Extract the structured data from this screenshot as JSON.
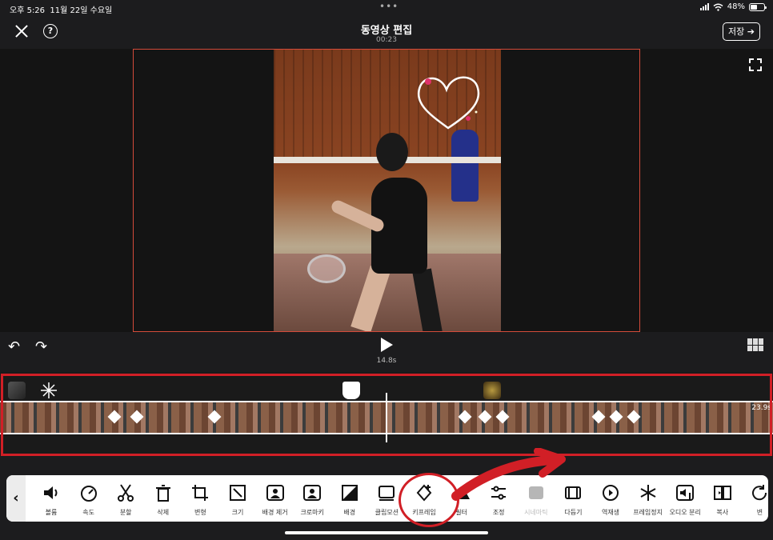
{
  "status": {
    "time": "오후 5:26",
    "date": "11월 22일 수요일",
    "battery": "48%"
  },
  "header": {
    "title": "동영상 편집",
    "subtitle": "00:23",
    "save_label": "저장 ➔"
  },
  "player": {
    "current_time": "14.8s"
  },
  "timeline": {
    "duration_label": "23.9s"
  },
  "toolbar": {
    "back_label": "‹",
    "tools": [
      {
        "label": "볼륨",
        "icon": "volume-icon"
      },
      {
        "label": "속도",
        "icon": "speed-icon"
      },
      {
        "label": "분할",
        "icon": "scissors-icon"
      },
      {
        "label": "삭제",
        "icon": "trash-icon"
      },
      {
        "label": "변형",
        "icon": "crop-icon"
      },
      {
        "label": "크기",
        "icon": "resize-icon"
      },
      {
        "label": "배경 제거",
        "icon": "remove-background-icon"
      },
      {
        "label": "크로마키",
        "icon": "chroma-key-icon"
      },
      {
        "label": "배경",
        "icon": "background-icon"
      },
      {
        "label": "클립모션",
        "icon": "clip-motion-icon"
      },
      {
        "label": "키프레임",
        "icon": "keyframe-icon"
      },
      {
        "label": "필터",
        "icon": "filter-icon"
      },
      {
        "label": "조정",
        "icon": "adjust-icon"
      },
      {
        "label": "시네마틱",
        "icon": "cinematic-icon"
      },
      {
        "label": "다듬기",
        "icon": "trim-icon"
      },
      {
        "label": "역재생",
        "icon": "reverse-icon"
      },
      {
        "label": "프레임정지",
        "icon": "freeze-frame-icon"
      },
      {
        "label": "오디오 분리",
        "icon": "audio-detach-icon"
      },
      {
        "label": "복사",
        "icon": "copy-icon"
      },
      {
        "label": "변",
        "icon": "replace-icon"
      }
    ]
  },
  "colors": {
    "highlight": "#d11f26",
    "frame_border": "#d34b3a"
  }
}
